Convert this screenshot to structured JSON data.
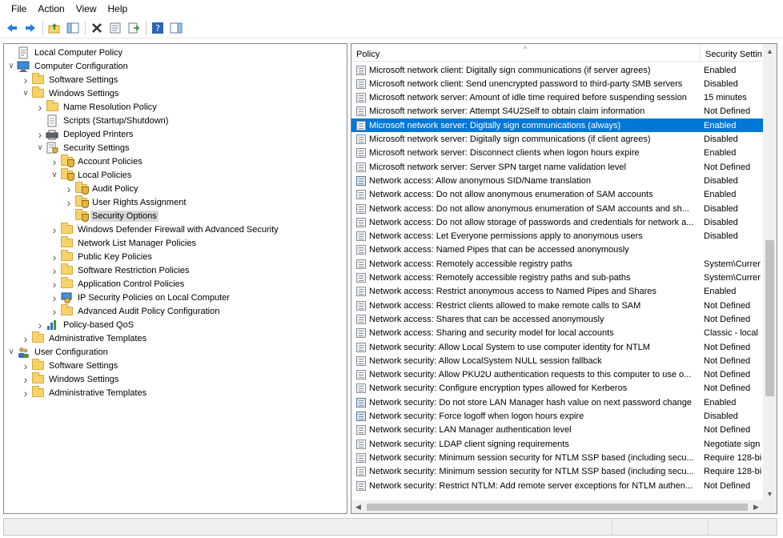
{
  "menu": [
    "File",
    "Action",
    "View",
    "Help"
  ],
  "toolbar": {
    "buttons": [
      "back-arrow-icon",
      "forward-arrow-icon",
      "up-folder-icon",
      "show-hide-tree-icon",
      "delete-icon",
      "properties-icon",
      "export-list-icon",
      "help-icon",
      "show-action-pane-icon"
    ]
  },
  "tree": [
    {
      "label": "Local Computer Policy",
      "depth": 0,
      "twisty": "",
      "icon": "policy-icon",
      "name": "tree-local-computer-policy"
    },
    {
      "label": "Computer Configuration",
      "depth": 0,
      "twisty": "down",
      "icon": "computer-icon",
      "name": "tree-computer-configuration"
    },
    {
      "label": "Software Settings",
      "depth": 1,
      "twisty": "right",
      "icon": "folder-icon",
      "name": "tree-software-settings"
    },
    {
      "label": "Windows Settings",
      "depth": 1,
      "twisty": "down",
      "icon": "folder-icon",
      "name": "tree-windows-settings"
    },
    {
      "label": "Name Resolution Policy",
      "depth": 2,
      "twisty": "right",
      "icon": "folder-icon",
      "name": "tree-name-resolution-policy"
    },
    {
      "label": "Scripts (Startup/Shutdown)",
      "depth": 2,
      "twisty": "",
      "icon": "script-icon",
      "name": "tree-scripts"
    },
    {
      "label": "Deployed Printers",
      "depth": 2,
      "twisty": "right",
      "icon": "printer-icon",
      "name": "tree-deployed-printers"
    },
    {
      "label": "Security Settings",
      "depth": 2,
      "twisty": "down",
      "icon": "security-settings-icon",
      "name": "tree-security-settings"
    },
    {
      "label": "Account Policies",
      "depth": 3,
      "twisty": "right",
      "icon": "shield-folder-icon",
      "name": "tree-account-policies"
    },
    {
      "label": "Local Policies",
      "depth": 3,
      "twisty": "down",
      "icon": "shield-folder-icon",
      "name": "tree-local-policies"
    },
    {
      "label": "Audit Policy",
      "depth": 4,
      "twisty": "right",
      "icon": "shield-folder-icon",
      "name": "tree-audit-policy"
    },
    {
      "label": "User Rights Assignment",
      "depth": 4,
      "twisty": "right",
      "icon": "shield-folder-icon",
      "name": "tree-user-rights-assignment"
    },
    {
      "label": "Security Options",
      "depth": 4,
      "twisty": "",
      "icon": "shield-folder-icon",
      "name": "tree-security-options",
      "selected": true
    },
    {
      "label": "Windows Defender Firewall with Advanced Security",
      "depth": 3,
      "twisty": "right",
      "icon": "folder-icon",
      "name": "tree-defender-firewall"
    },
    {
      "label": "Network List Manager Policies",
      "depth": 3,
      "twisty": "",
      "icon": "folder-icon",
      "name": "tree-network-list-manager"
    },
    {
      "label": "Public Key Policies",
      "depth": 3,
      "twisty": "right",
      "icon": "folder-icon",
      "name": "tree-public-key-policies"
    },
    {
      "label": "Software Restriction Policies",
      "depth": 3,
      "twisty": "right",
      "icon": "folder-icon",
      "name": "tree-software-restriction"
    },
    {
      "label": "Application Control Policies",
      "depth": 3,
      "twisty": "right",
      "icon": "folder-icon",
      "name": "tree-application-control"
    },
    {
      "label": "IP Security Policies on Local Computer",
      "depth": 3,
      "twisty": "right",
      "icon": "ip-security-icon",
      "name": "tree-ip-security"
    },
    {
      "label": "Advanced Audit Policy Configuration",
      "depth": 3,
      "twisty": "right",
      "icon": "folder-icon",
      "name": "tree-advanced-audit"
    },
    {
      "label": "Policy-based QoS",
      "depth": 2,
      "twisty": "right",
      "icon": "qos-chart-icon",
      "name": "tree-policy-based-qos"
    },
    {
      "label": "Administrative Templates",
      "depth": 1,
      "twisty": "right",
      "icon": "folder-icon",
      "name": "tree-admin-templates-computer"
    },
    {
      "label": "User Configuration",
      "depth": 0,
      "twisty": "down",
      "icon": "users-icon",
      "name": "tree-user-configuration"
    },
    {
      "label": "Software Settings",
      "depth": 1,
      "twisty": "right",
      "icon": "folder-icon",
      "name": "tree-user-software-settings"
    },
    {
      "label": "Windows Settings",
      "depth": 1,
      "twisty": "right",
      "icon": "folder-icon",
      "name": "tree-user-windows-settings"
    },
    {
      "label": "Administrative Templates",
      "depth": 1,
      "twisty": "right",
      "icon": "folder-icon",
      "name": "tree-user-admin-templates"
    }
  ],
  "list": {
    "columns": {
      "policy": "Policy",
      "setting": "Security Settin"
    },
    "sort_indicator": "^",
    "rows": [
      {
        "policy": "Microsoft network client: Digitally sign communications (if server agrees)",
        "setting": "Enabled"
      },
      {
        "policy": "Microsoft network client: Send unencrypted password to third-party SMB servers",
        "setting": "Disabled"
      },
      {
        "policy": "Microsoft network server: Amount of idle time required before suspending session",
        "setting": "15 minutes"
      },
      {
        "policy": "Microsoft network server: Attempt S4U2Self to obtain claim information",
        "setting": "Not Defined"
      },
      {
        "policy": "Microsoft network server: Digitally sign communications (always)",
        "setting": "Enabled",
        "selected": true
      },
      {
        "policy": "Microsoft network server: Digitally sign communications (if client agrees)",
        "setting": "Disabled"
      },
      {
        "policy": "Microsoft network server: Disconnect clients when logon hours expire",
        "setting": "Enabled"
      },
      {
        "policy": "Microsoft network server: Server SPN target name validation level",
        "setting": "Not Defined"
      },
      {
        "policy": "Network access: Allow anonymous SID/Name translation",
        "setting": "Disabled",
        "alt_icon": true
      },
      {
        "policy": "Network access: Do not allow anonymous enumeration of SAM accounts",
        "setting": "Enabled"
      },
      {
        "policy": "Network access: Do not allow anonymous enumeration of SAM accounts and sh...",
        "setting": "Disabled"
      },
      {
        "policy": "Network access: Do not allow storage of passwords and credentials for network a...",
        "setting": "Disabled"
      },
      {
        "policy": "Network access: Let Everyone permissions apply to anonymous users",
        "setting": "Disabled"
      },
      {
        "policy": "Network access: Named Pipes that can be accessed anonymously",
        "setting": ""
      },
      {
        "policy": "Network access: Remotely accessible registry paths",
        "setting": "System\\Currer"
      },
      {
        "policy": "Network access: Remotely accessible registry paths and sub-paths",
        "setting": "System\\Currer"
      },
      {
        "policy": "Network access: Restrict anonymous access to Named Pipes and Shares",
        "setting": "Enabled"
      },
      {
        "policy": "Network access: Restrict clients allowed to make remote calls to SAM",
        "setting": "Not Defined"
      },
      {
        "policy": "Network access: Shares that can be accessed anonymously",
        "setting": "Not Defined"
      },
      {
        "policy": "Network access: Sharing and security model for local accounts",
        "setting": "Classic - local"
      },
      {
        "policy": "Network security: Allow Local System to use computer identity for NTLM",
        "setting": "Not Defined"
      },
      {
        "policy": "Network security: Allow LocalSystem NULL session fallback",
        "setting": "Not Defined"
      },
      {
        "policy": "Network security: Allow PKU2U authentication requests to this computer to use o...",
        "setting": "Not Defined"
      },
      {
        "policy": "Network security: Configure encryption types allowed for Kerberos",
        "setting": "Not Defined"
      },
      {
        "policy": "Network security: Do not store LAN Manager hash value on next password change",
        "setting": "Enabled",
        "alt_icon": true
      },
      {
        "policy": "Network security: Force logoff when logon hours expire",
        "setting": "Disabled",
        "alt_icon": true
      },
      {
        "policy": "Network security: LAN Manager authentication level",
        "setting": "Not Defined"
      },
      {
        "policy": "Network security: LDAP client signing requirements",
        "setting": "Negotiate sign"
      },
      {
        "policy": "Network security: Minimum session security for NTLM SSP based (including secu...",
        "setting": "Require 128-bi"
      },
      {
        "policy": "Network security: Minimum session security for NTLM SSP based (including secu...",
        "setting": "Require 128-bi"
      },
      {
        "policy": "Network security: Restrict NTLM: Add remote server exceptions for NTLM authen...",
        "setting": "Not Defined"
      }
    ]
  },
  "colors": {
    "selection": "#0078d7",
    "tree_selection": "#d9d9d9"
  }
}
